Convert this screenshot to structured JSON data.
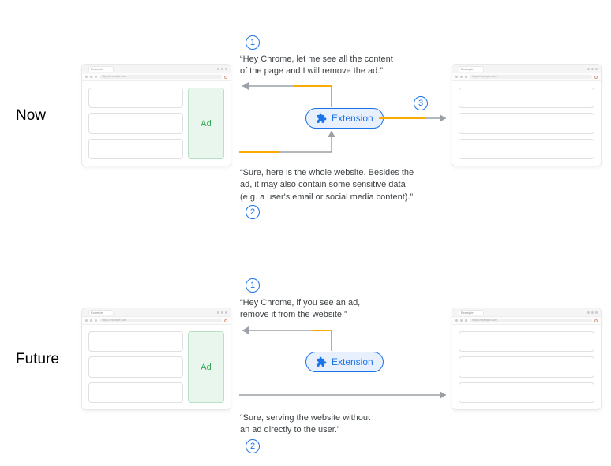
{
  "sections": {
    "now": {
      "label": "Now",
      "browser": {
        "tab": "Example",
        "url": "https://example.com",
        "ad_label": "Ad"
      },
      "steps": {
        "s1": "1",
        "s2": "2",
        "s3": "3"
      },
      "quote1": "“Hey Chrome, let me see all the content\n of the page and I will remove the ad.”",
      "quote2": "“Sure, here is the whole website. Besides the\n ad, it may also contain some sensitive data\n (e.g. a user's email or social media content).”",
      "extension_label": "Extension"
    },
    "future": {
      "label": "Future",
      "browser": {
        "tab": "Example",
        "url": "https://example.com",
        "ad_label": "Ad"
      },
      "steps": {
        "s1": "1",
        "s2": "2"
      },
      "quote1": "“Hey Chrome, if you see an ad,\nremove it from the website.”",
      "quote2": "“Sure, serving the website without\n an ad directly to the user.”",
      "extension_label": "Extension"
    }
  },
  "colors": {
    "blue": "#1a73e8",
    "blue_light": "#e8f0fe",
    "green": "#34a853",
    "green_light": "#e9f6ee",
    "orange": "#f9ab00",
    "grey": "#9aa0a6"
  }
}
